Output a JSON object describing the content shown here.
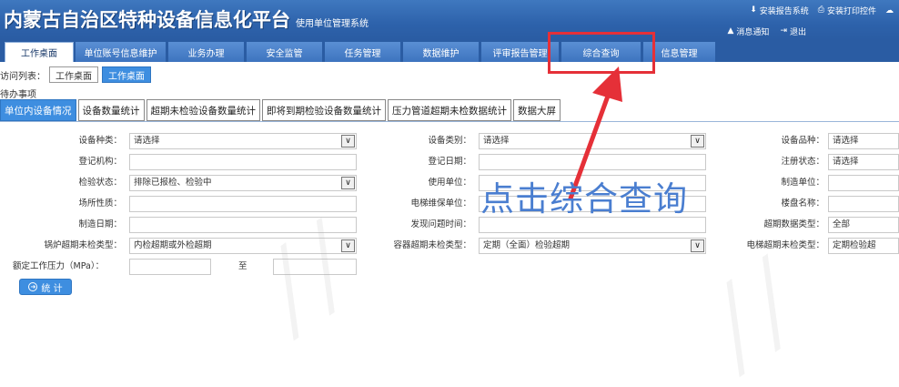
{
  "header": {
    "title": "内蒙古自治区特种设备信息化平台",
    "subtitle": "使用单位管理系统",
    "links_top": [
      {
        "label": "安装报告系统",
        "icon": "download-icon"
      },
      {
        "label": "安装打印控件",
        "icon": "printer-icon"
      }
    ],
    "links_bottom": [
      {
        "label": "消息通知",
        "icon": "bell-icon"
      },
      {
        "label": "退出",
        "icon": "logout-icon"
      }
    ]
  },
  "nav": {
    "items": [
      {
        "label": "工作桌面"
      },
      {
        "label": "单位账号信息维护"
      },
      {
        "label": "业务办理"
      },
      {
        "label": "安全监管"
      },
      {
        "label": "任务管理"
      },
      {
        "label": "数据维护"
      },
      {
        "label": "评审报告管理"
      },
      {
        "label": "综合查询"
      },
      {
        "label": "信息管理"
      }
    ],
    "active_index": 0
  },
  "access": {
    "label": "访问列表：",
    "tabs": [
      "工作桌面",
      "工作桌面"
    ]
  },
  "pending_label": "待办事项",
  "subtabs": {
    "items": [
      "单位内设备情况",
      "设备数量统计",
      "超期未检验设备数量统计",
      "即将到期检验设备数量统计",
      "压力管道超期未检数据统计",
      "数据大屏"
    ],
    "active_index": 0
  },
  "form": {
    "equip_type": {
      "label": "设备种类：",
      "value": "请选择"
    },
    "equip_category": {
      "label": "设备类别：",
      "value": "请选择"
    },
    "equip_variety": {
      "label": "设备品种：",
      "value": "请选择"
    },
    "reg_org": {
      "label": "登记机构：",
      "value": ""
    },
    "reg_date": {
      "label": "登记日期：",
      "value": ""
    },
    "reg_status": {
      "label": "注册状态：",
      "value": "请选择"
    },
    "inspect_status": {
      "label": "检验状态：",
      "value": "排除已报检、检验中"
    },
    "use_unit": {
      "label": "使用单位：",
      "value": ""
    },
    "maker": {
      "label": "制造单位：",
      "value": ""
    },
    "site_nature": {
      "label": "场所性质：",
      "value": ""
    },
    "elevator_maint": {
      "label": "电梯维保单位：",
      "value": ""
    },
    "building_name": {
      "label": "楼盘名称：",
      "value": ""
    },
    "make_date": {
      "label": "制造日期：",
      "value": ""
    },
    "found_time": {
      "label": "发现问题时间：",
      "value": ""
    },
    "overdue_data_type": {
      "label": "超期数据类型：",
      "value": "全部"
    },
    "boiler_overdue": {
      "label": "锅炉超期未检类型：",
      "value": "内检超期或外检超期"
    },
    "vessel_overdue": {
      "label": "容器超期未检类型：",
      "value": "定期（全面）检验超期"
    },
    "elevator_overdue": {
      "label": "电梯超期未检类型：",
      "value": "定期检验超"
    },
    "pressure": {
      "label": "额定工作压力（MPa）：",
      "to": "至"
    }
  },
  "stat_button": {
    "label": "统 计",
    "icon": "arrow-right-circle-icon"
  },
  "annotation": {
    "text": "点击综合查询",
    "color": "#e53038"
  },
  "colors": {
    "brand": "#2a5ca3",
    "accent": "#3e8ee0",
    "annotation_text": "#4a7ed0"
  }
}
